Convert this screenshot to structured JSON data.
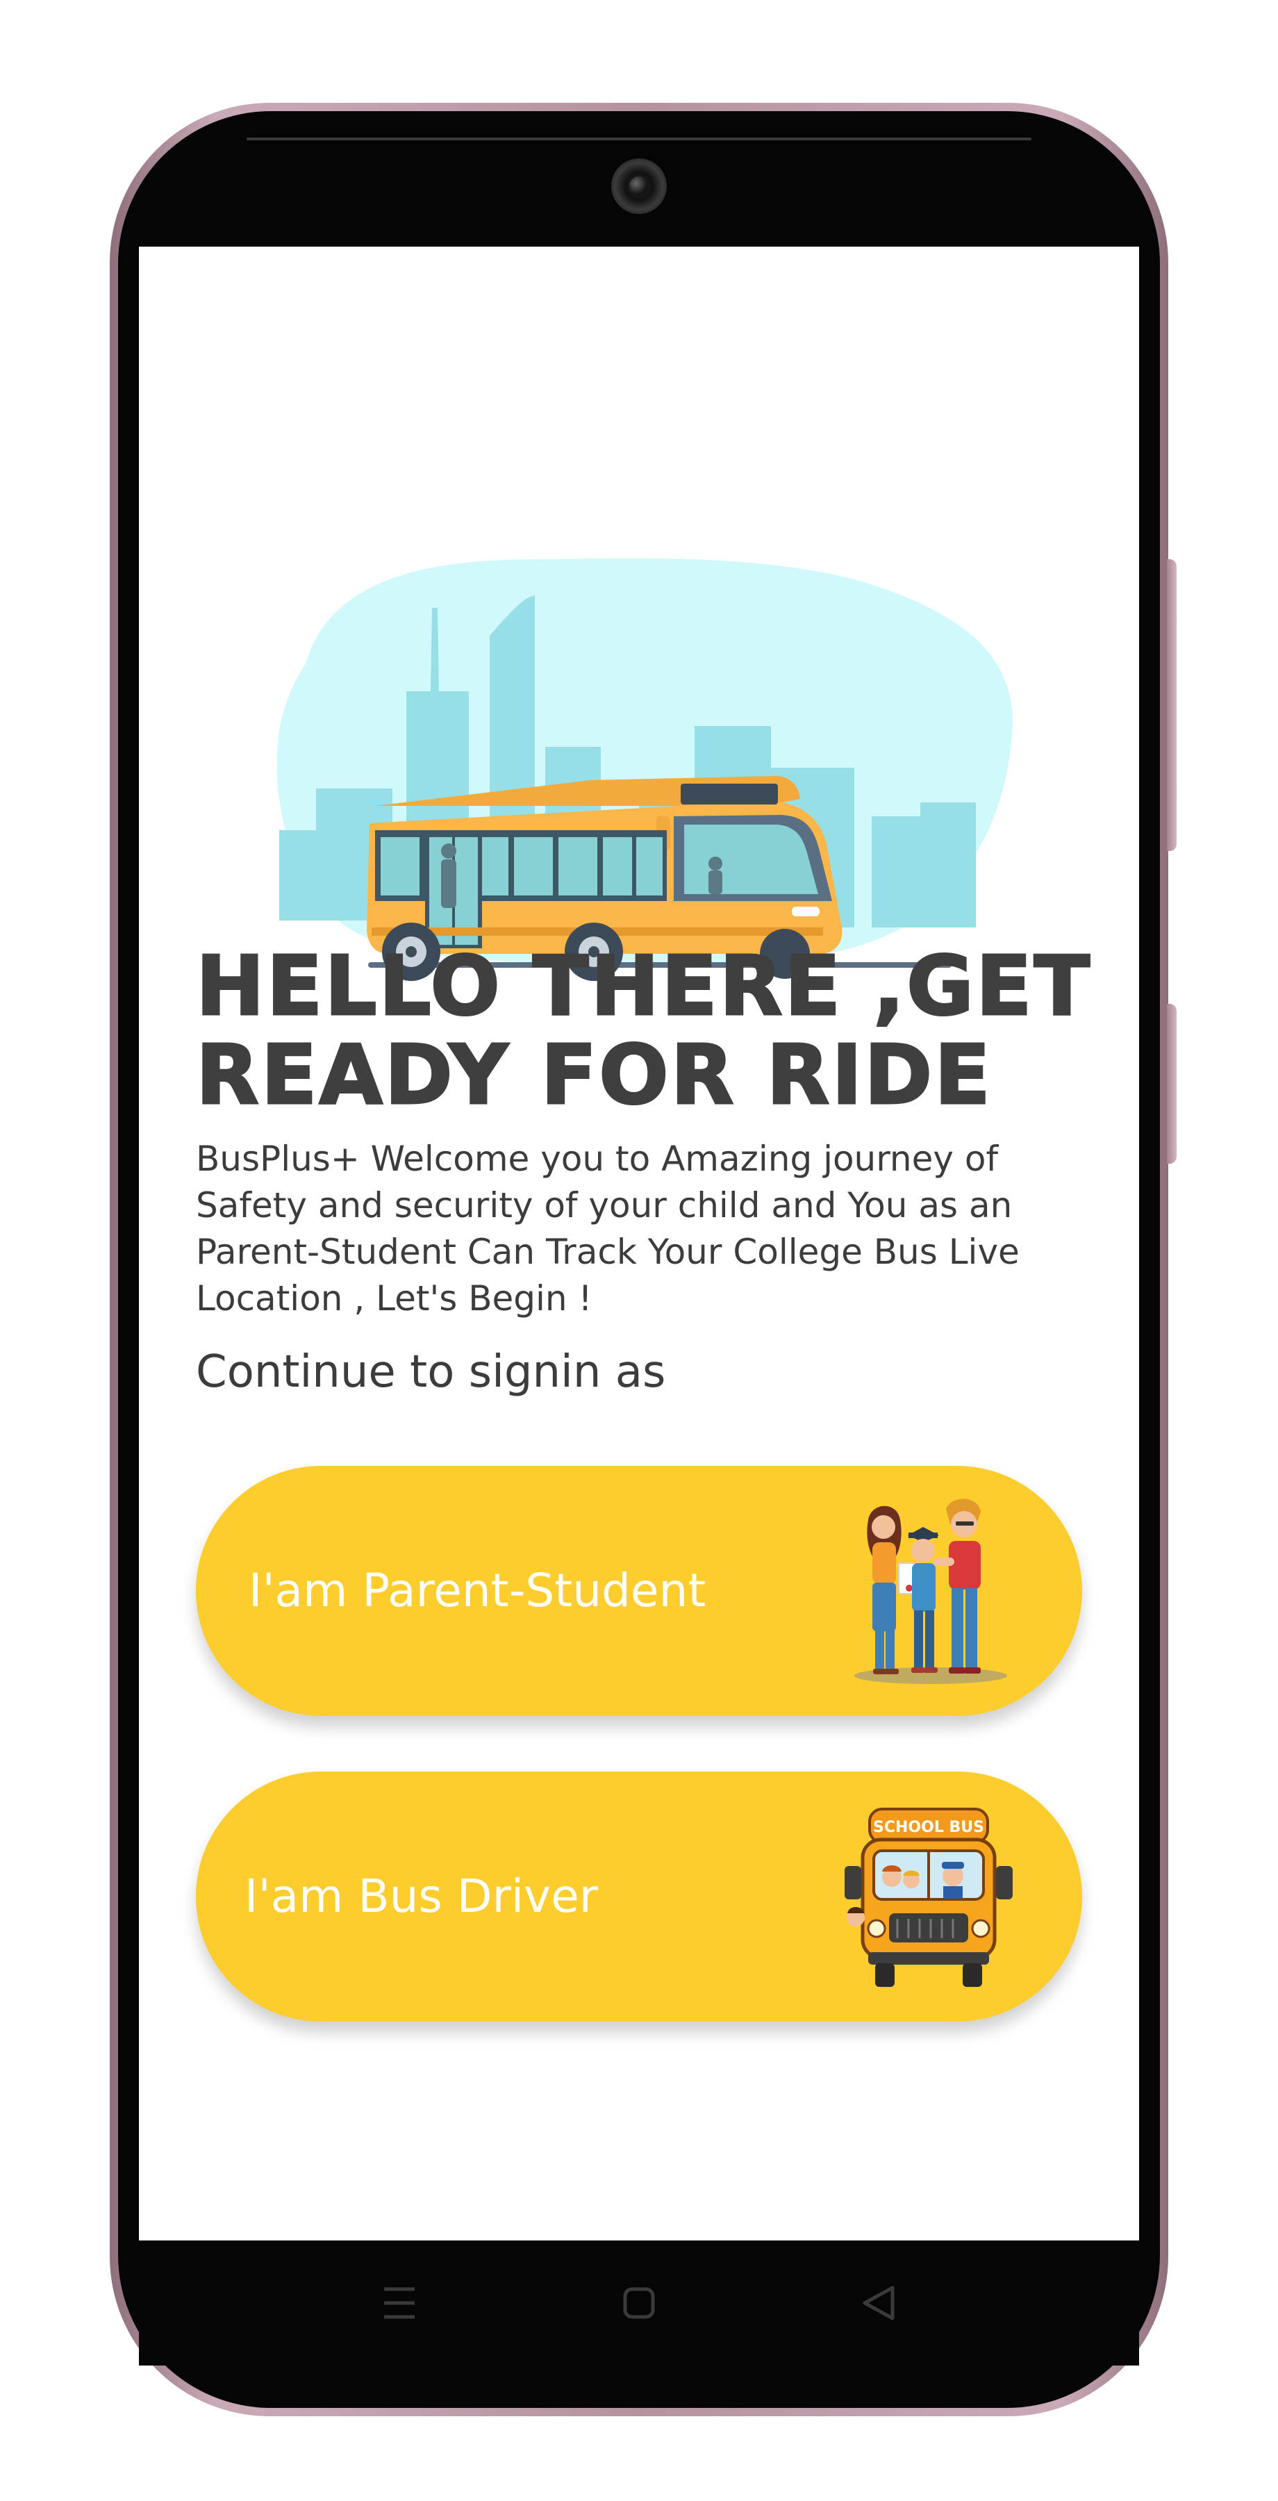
{
  "app": {
    "headline": "HELLO THERE ,GET READY FOR RIDE",
    "intro": "BusPlus+ Welcome you to Amazing journey of Safety and security of your child and You as an Parent-Student Can Track Your College Bus Live Location , Let's Begin !",
    "continue_label": "Continue to signin as"
  },
  "roles": {
    "parent_student": {
      "label": "I'am Parent-Student",
      "art_text": ""
    },
    "bus_driver": {
      "label": "I'am Bus Driver",
      "art_text": "SCHOOL BUS"
    }
  },
  "navigation": {
    "menu_icon": "menu-icon",
    "home_icon": "home-square-icon",
    "back_icon": "back-triangle-icon"
  },
  "colors": {
    "primary": "#fdcd2d",
    "heading": "#3f3f3f",
    "body_text": "#3c3c3c",
    "button_text": "#ffffff",
    "hero_sky": "#d1f8fb",
    "bus_body": "#fbb64a"
  }
}
